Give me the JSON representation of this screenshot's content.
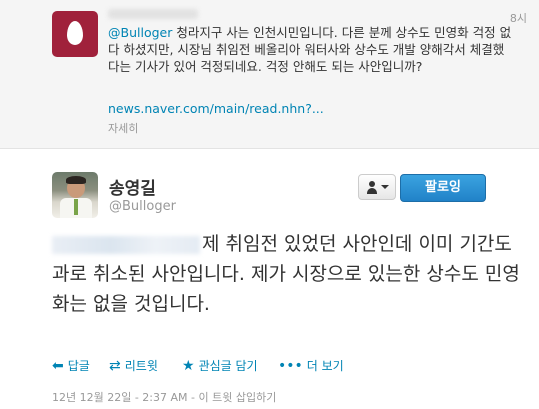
{
  "reply": {
    "time": "8시",
    "mention": "@Bulloger",
    "text": " 청라지구 사는 인천시민입니다. 다른 분께 상수도 민영화 걱정 없다 하셨지만, 시장님 취임전 베올리아 워터사와 상수도 개발 양해각서 체결했다는 기사가 있어 걱정되네요. 걱정 안해도 되는 사안입니까?",
    "link": "news.naver.com/main/read.nhn?...",
    "expand": "자세히"
  },
  "user": {
    "name": "송영길",
    "handle": "@Bulloger",
    "follow_label": "팔로잉"
  },
  "tweet": {
    "text": "제 취임전 있었던 사안인데 이미 기간도과로 취소된 사안입니다. 제가 시장으로 있는한 상수도 민영화는 없을 것입니다."
  },
  "actions": {
    "reply": "답글",
    "retweet": "리트윗",
    "favorite": "관심글 담기",
    "more": "더 보기"
  },
  "meta": {
    "timestamp": "12년 12월 22일 - 2:37 AM - 이 트윗 삽입하기"
  },
  "colors": {
    "link": "#0084b4",
    "follow_button": "#2182c8",
    "egg_avatar": "#a0213b"
  },
  "icons": {
    "reply": "reply-arrow-icon",
    "retweet": "retweet-icon",
    "favorite": "star-icon",
    "more": "more-dots-icon",
    "user_menu": "person-dropdown-icon"
  }
}
